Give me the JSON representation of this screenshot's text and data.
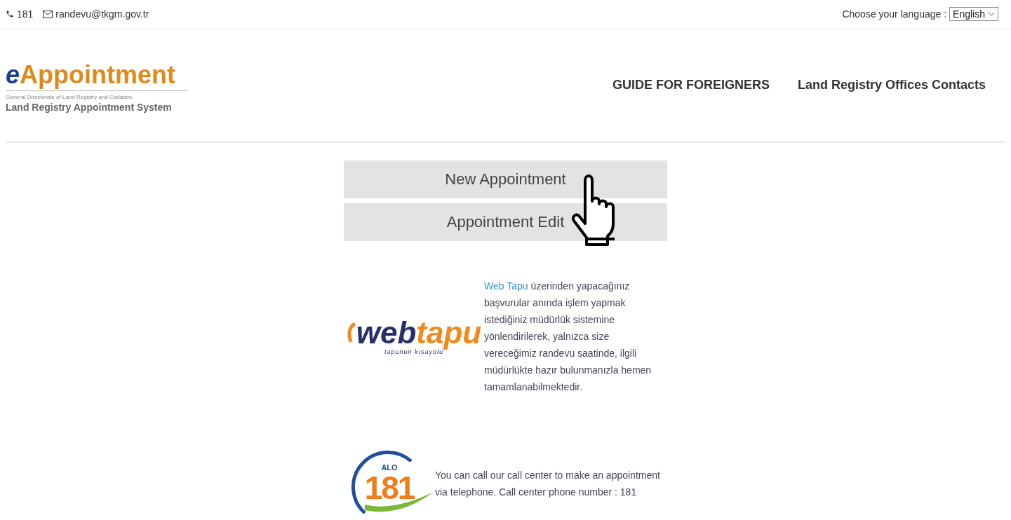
{
  "top_bar": {
    "phone": "181",
    "email": "randevu@tkgm.gov.tr",
    "language_label": "Choose your language :",
    "language_select": {
      "value": "English"
    }
  },
  "logo": {
    "prefix": "e",
    "name": "Appointment",
    "subtitle": "General Directorate of Land Registry and Cadastre",
    "system": "Land Registry Appointment System"
  },
  "nav": [
    {
      "label": "GUIDE FOR FOREIGNERS"
    },
    {
      "label": "Land Registry Offices Contacts"
    }
  ],
  "buttons": [
    {
      "label": "New Appointment"
    },
    {
      "label": "Appointment Edit"
    }
  ],
  "webtapu": {
    "logo_dark": "web",
    "logo_orange": "tapu",
    "logo_tagline": "tapunun kısayolu",
    "link": "Web Tapu",
    "text": "üzerinden yapacağınız başvurular anında işlem yapmak istediğiniz müdürlük sistemine yönlendirilerek, yalnızca size vereceğimiz randevu saatinde, ilgili müdürlükte hazır bulunmanızla hemen tamamlanabilmektedir."
  },
  "call_center": {
    "logo_top": "ALO",
    "logo_number": "181",
    "text": "You can call our call center to make an appointment via telephone. Call center phone number : 181"
  }
}
